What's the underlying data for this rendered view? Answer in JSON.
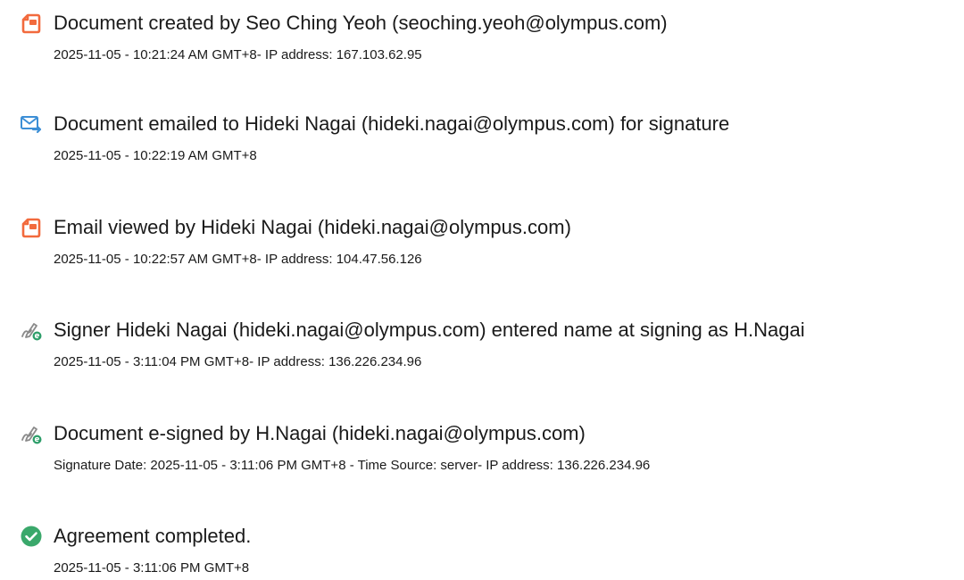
{
  "events": [
    {
      "icon": "document-created-icon",
      "title": "Document created by Seo Ching Yeoh (seoching.yeoh@olympus.com)",
      "detail": "2025-11-05 - 10:21:24 AM GMT+8- IP address: 167.103.62.95"
    },
    {
      "icon": "email-sent-icon",
      "title": "Document emailed to Hideki Nagai (hideki.nagai@olympus.com) for signature",
      "detail": "2025-11-05 - 10:22:19 AM GMT+8"
    },
    {
      "icon": "document-viewed-icon",
      "title": "Email viewed by Hideki Nagai (hideki.nagai@olympus.com)",
      "detail": "2025-11-05 - 10:22:57 AM GMT+8- IP address: 104.47.56.126"
    },
    {
      "icon": "e-sign-pen-icon",
      "title": "Signer Hideki Nagai (hideki.nagai@olympus.com) entered name at signing as H.Nagai",
      "detail": "2025-11-05 - 3:11:04 PM GMT+8- IP address: 136.226.234.96"
    },
    {
      "icon": "e-sign-pen-icon",
      "title": "Document e-signed by H.Nagai (hideki.nagai@olympus.com)",
      "detail": "Signature Date: 2025-11-05 - 3:11:06 PM GMT+8 - Time Source: server- IP address: 136.226.234.96"
    },
    {
      "icon": "check-circle-icon",
      "title": "Agreement completed.",
      "detail": "2025-11-05 - 3:11:06 PM GMT+8"
    }
  ],
  "colors": {
    "document_icon": "#f26a3d",
    "email_icon": "#3d8fd6",
    "pen_icon": "#8a8a8a",
    "pen_badge": "#2e9e6a",
    "check_icon": "#3aa86b"
  }
}
